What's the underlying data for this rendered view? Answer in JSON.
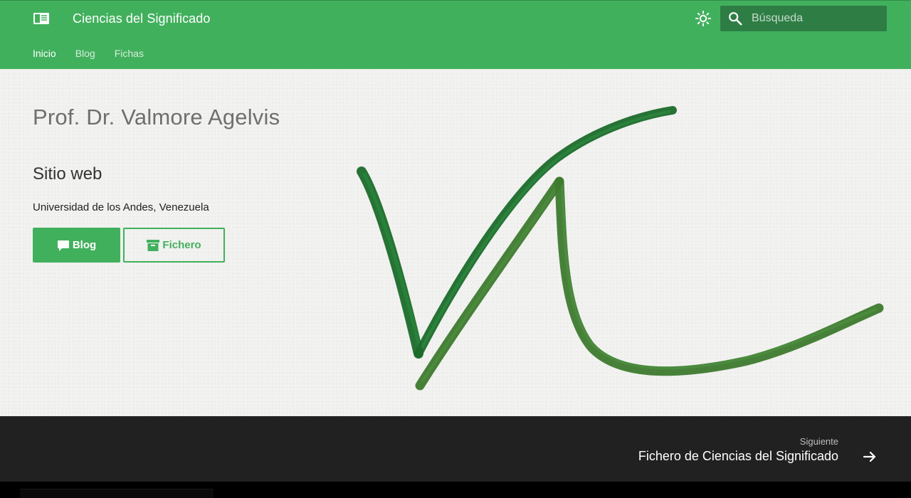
{
  "header": {
    "site_title": "Ciencias del Significado",
    "logo_icon": "book-icon",
    "theme_icon": "sun-icon",
    "search": {
      "placeholder": "Búsqueda",
      "value": "",
      "icon": "search-icon"
    },
    "tabs": [
      {
        "label": "Inicio",
        "active": true
      },
      {
        "label": "Blog",
        "active": false
      },
      {
        "label": "Fichas",
        "active": false
      }
    ]
  },
  "hero": {
    "title": "Prof. Dr. Valmore Agelvis",
    "subtitle": "Sitio web",
    "text": "Universidad de los Andes, Venezuela",
    "buttons": {
      "blog": {
        "label": "Blog",
        "icon": "comment-icon"
      },
      "fichero": {
        "label": "Fichero",
        "icon": "archive-icon"
      }
    },
    "signature": "VA monogram"
  },
  "footer": {
    "next_label": "Siguiente",
    "next_link": "Fichero de Ciencias del Significado",
    "arrow_icon": "arrow-right-icon"
  },
  "colors": {
    "primary": "#41b05d",
    "primary_dark": "#2e7d45",
    "footer_bg": "#212121",
    "hero_bg": "#f2f2f0",
    "signature_dark": "#1a6b2a",
    "signature_light": "#3d7a2e"
  }
}
